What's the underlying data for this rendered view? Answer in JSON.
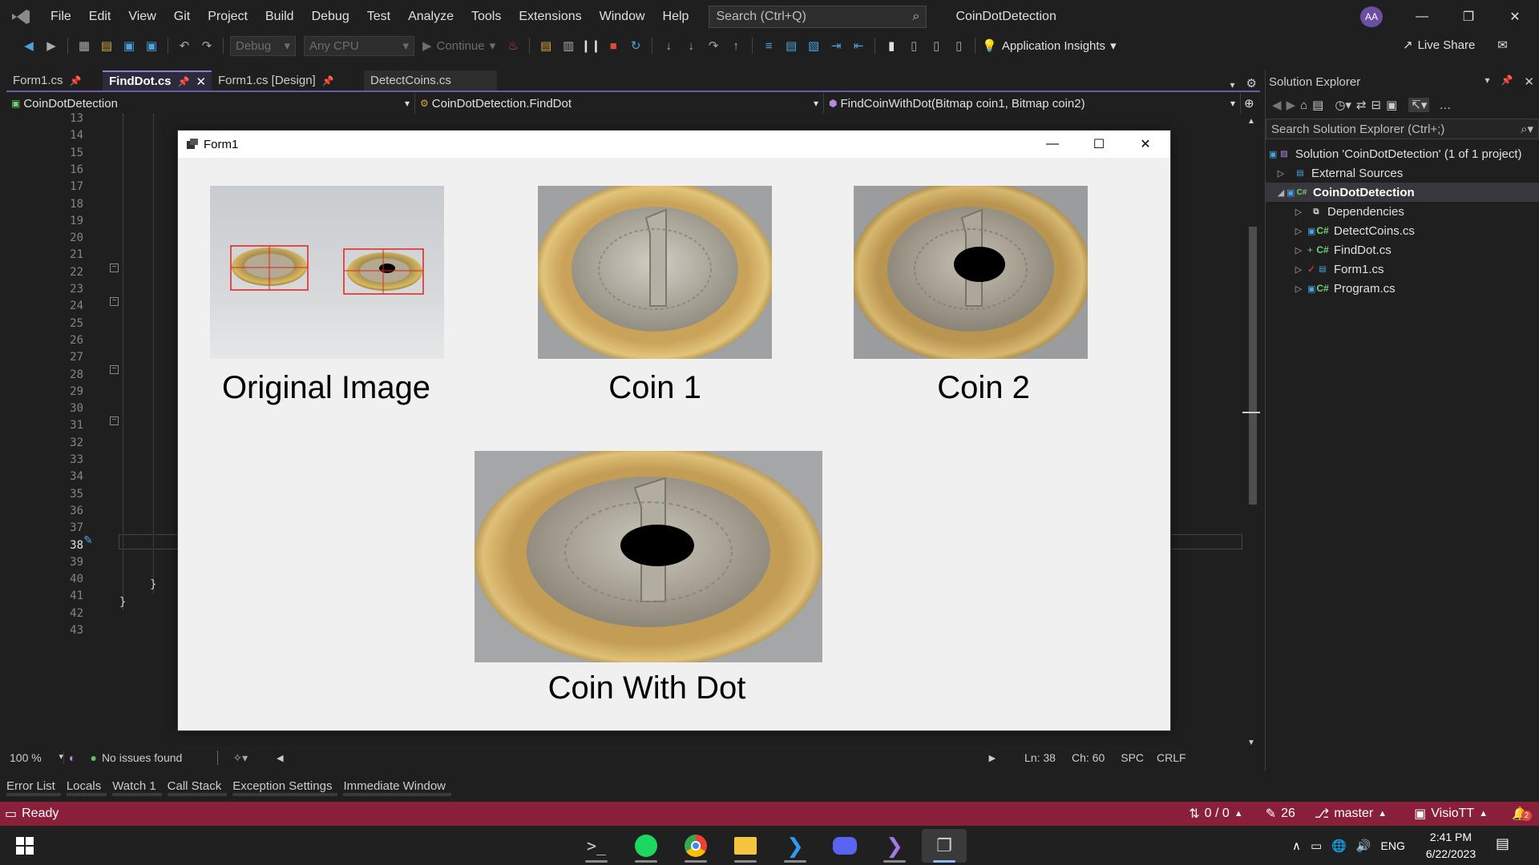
{
  "menu": {
    "items": [
      "File",
      "Edit",
      "View",
      "Git",
      "Project",
      "Build",
      "Debug",
      "Test",
      "Analyze",
      "Tools",
      "Extensions",
      "Window",
      "Help"
    ],
    "search_placeholder": "Search (Ctrl+Q)",
    "app_title": "CoinDotDetection",
    "avatar_initials": "AA"
  },
  "toolbar": {
    "config": "Debug",
    "platform": "Any CPU",
    "continue_label": "Continue",
    "app_insights_label": "Application Insights",
    "live_share_label": "Live Share"
  },
  "doc_tabs": [
    {
      "label": "Form1.cs",
      "active": false
    },
    {
      "label": "FindDot.cs",
      "active": true
    },
    {
      "label": "Form1.cs [Design]",
      "active": false
    },
    {
      "label": "DetectCoins.cs",
      "active": false
    }
  ],
  "navbar": {
    "project": "CoinDotDetection",
    "class": "CoinDotDetection.FindDot",
    "member": "FindCoinWithDot(Bitmap coin1, Bitmap coin2)"
  },
  "editor": {
    "line_numbers": [
      "13",
      "14",
      "15",
      "16",
      "17",
      "18",
      "19",
      "20",
      "21",
      "22",
      "23",
      "24",
      "25",
      "26",
      "27",
      "28",
      "29",
      "30",
      "31",
      "32",
      "33",
      "34",
      "35",
      "36",
      "37",
      "38",
      "39",
      "40",
      "41",
      "42",
      "43"
    ],
    "current_line": "38",
    "brace_a": "}",
    "brace_b": "}",
    "zoom": "100 %",
    "issues": "No issues found",
    "ln": "Ln: 38",
    "ch": "Ch: 60",
    "spc": "SPC",
    "crlf": "CRLF"
  },
  "solution_explorer": {
    "title": "Solution Explorer",
    "search_placeholder": "Search Solution Explorer (Ctrl+;)",
    "solution": "Solution 'CoinDotDetection' (1 of 1 project)",
    "external_sources": "External Sources",
    "project": "CoinDotDetection",
    "items": [
      "Dependencies",
      "DetectCoins.cs",
      "FindDot.cs",
      "Form1.cs",
      "Program.cs"
    ]
  },
  "bottom_tabs": [
    "Error List",
    "Locals",
    "Watch 1",
    "Call Stack",
    "Exception Settings",
    "Immediate Window"
  ],
  "statusbar": {
    "ready": "Ready",
    "sync": "0 / 0",
    "pending_changes": "26",
    "branch": "master",
    "repo": "VisioTT",
    "notifications": "2"
  },
  "taskbar": {
    "language": "ENG",
    "time": "2:41 PM",
    "date": "6/22/2023"
  },
  "form1": {
    "title": "Form1",
    "captions": {
      "original": "Original Image",
      "coin1": "Coin 1",
      "coin2": "Coin 2",
      "coin_with_dot": "Coin With Dot"
    }
  },
  "colors": {
    "accent": "#6f5aa8",
    "statusbar": "#8a1f3c",
    "detection_box": "#e02020"
  }
}
